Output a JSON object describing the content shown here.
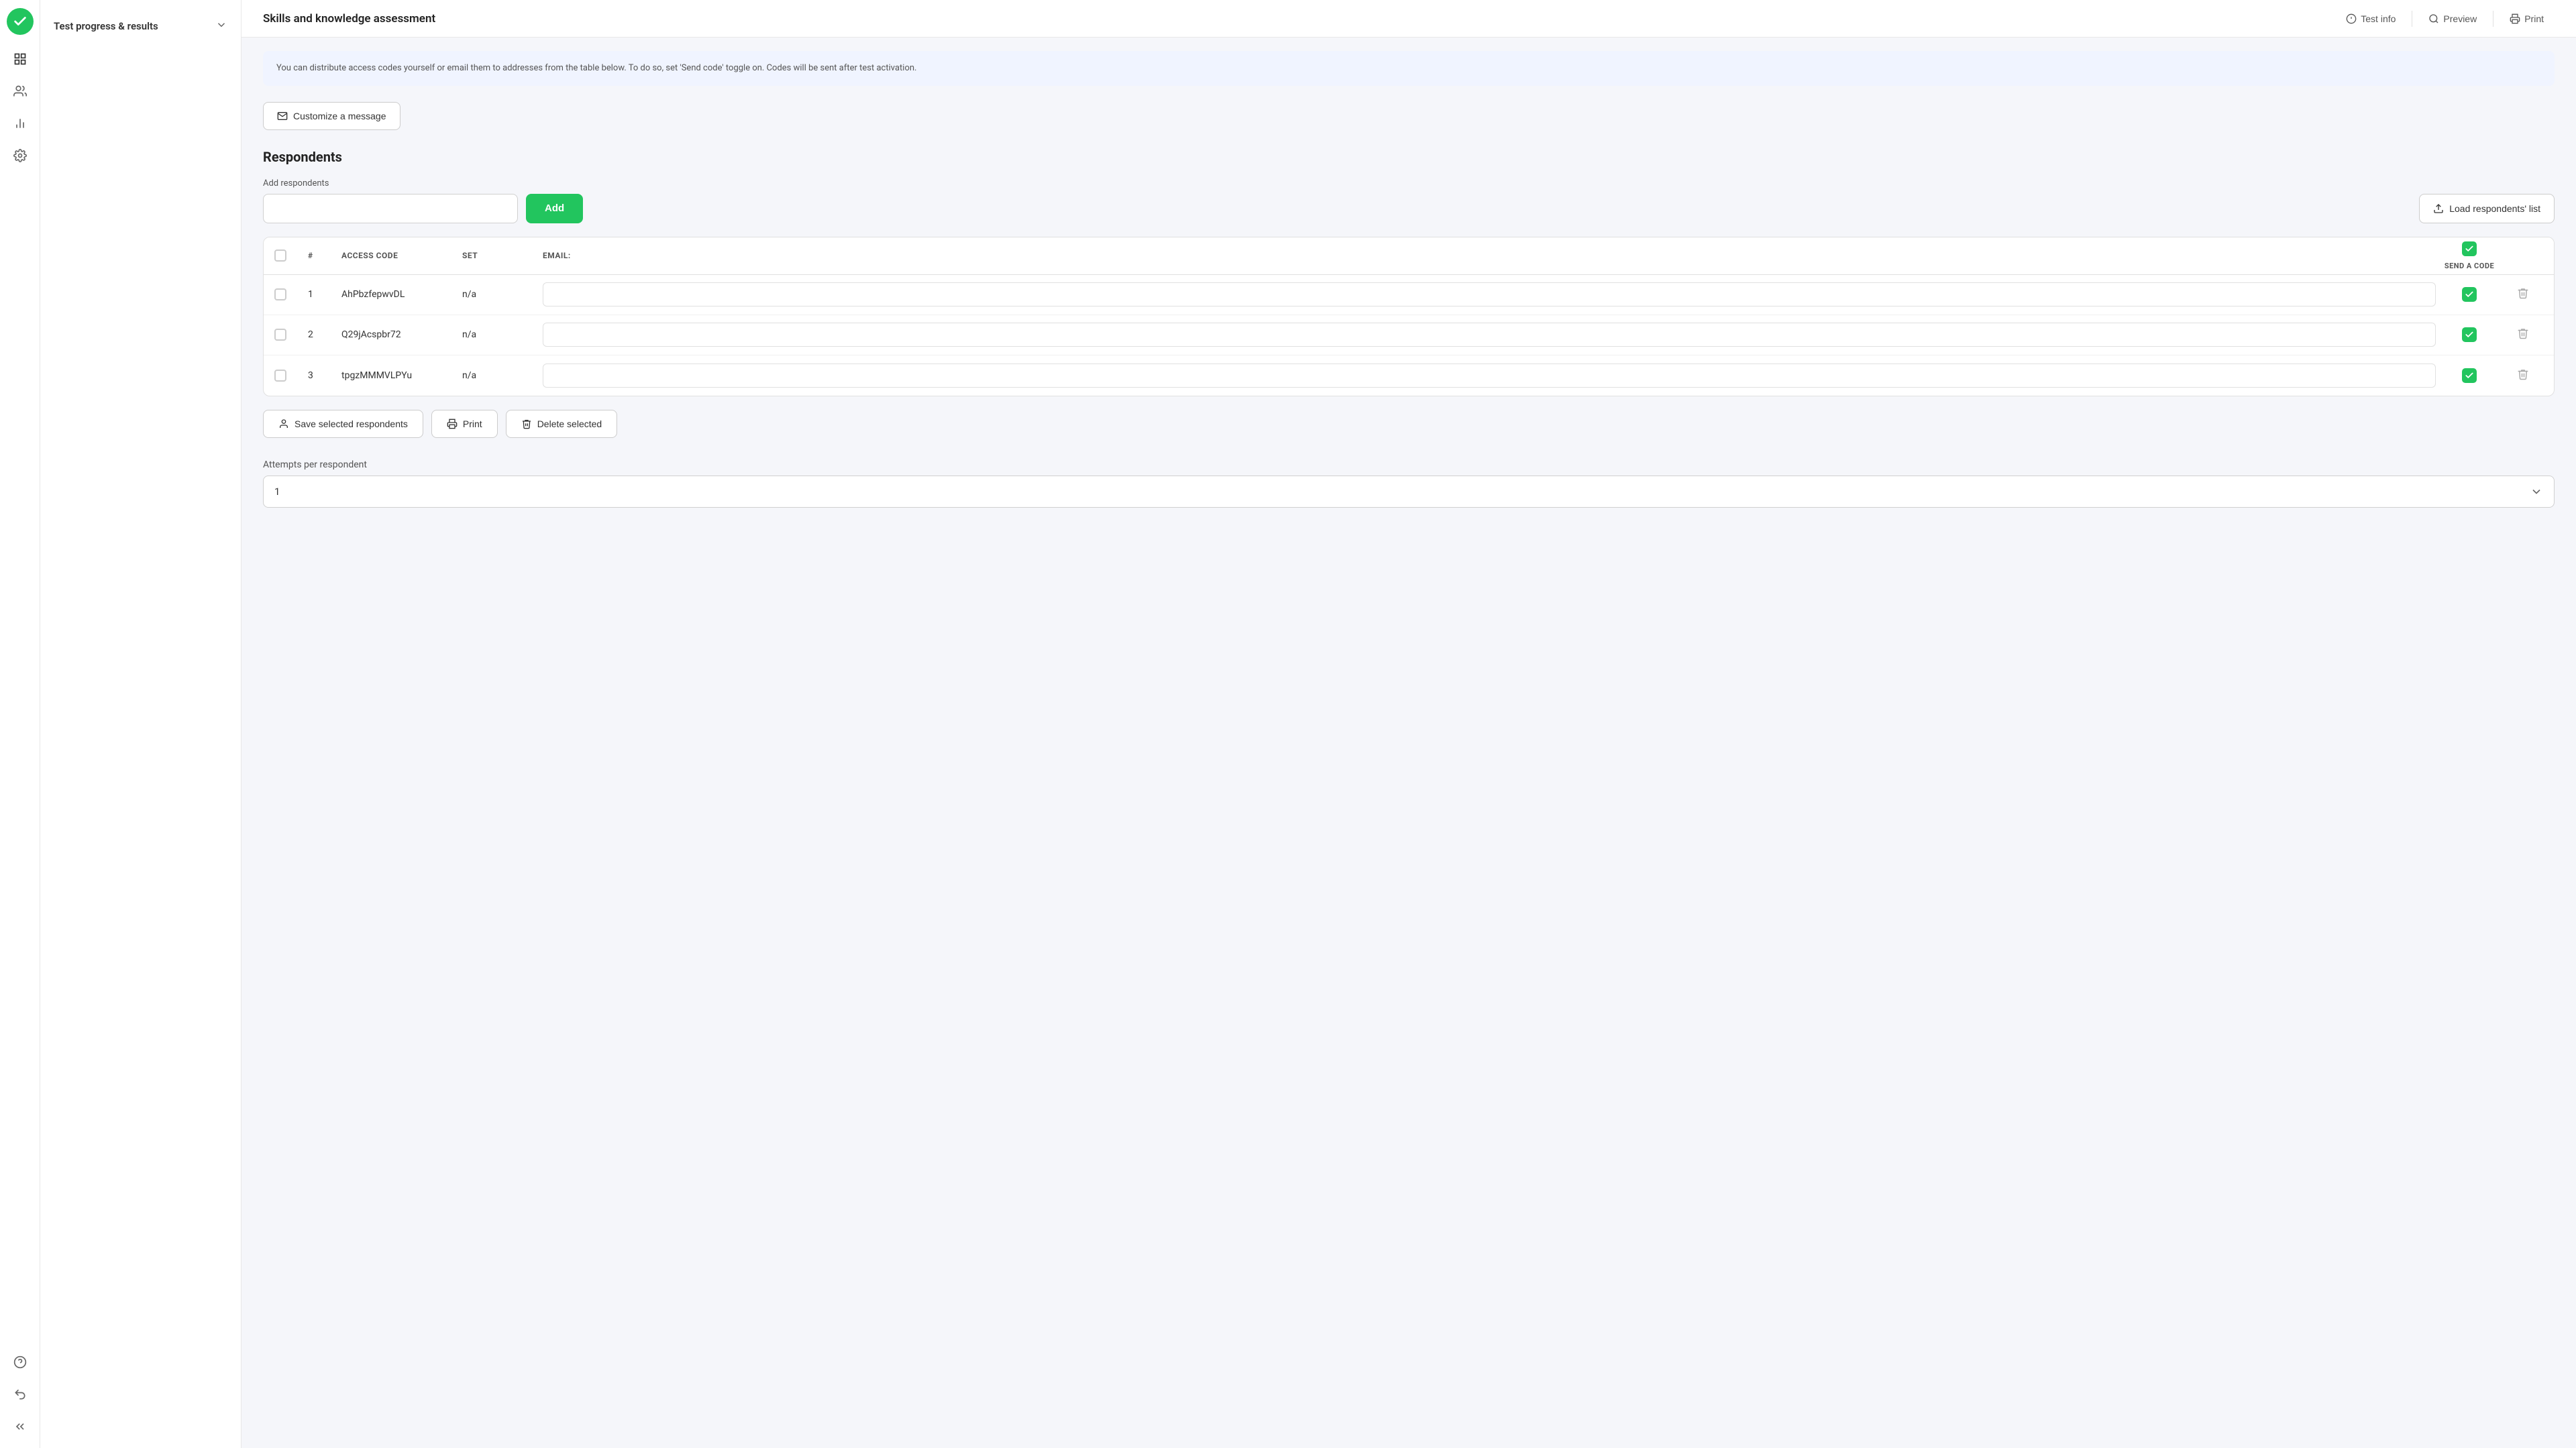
{
  "app": {
    "logo_icon": "check-icon",
    "title": "Skills and knowledge assessment"
  },
  "header": {
    "title": "Skills and knowledge assessment",
    "test_info_label": "Test info",
    "preview_label": "Preview",
    "print_label": "Print"
  },
  "icon_nav": {
    "items": [
      {
        "name": "grid-icon",
        "label": "Dashboard"
      },
      {
        "name": "users-icon",
        "label": "Users"
      },
      {
        "name": "chart-icon",
        "label": "Reports"
      },
      {
        "name": "settings-icon",
        "label": "Settings"
      }
    ],
    "bottom_items": [
      {
        "name": "help-icon",
        "label": "Help"
      },
      {
        "name": "back-icon",
        "label": "Back"
      },
      {
        "name": "collapse-icon",
        "label": "Collapse"
      }
    ]
  },
  "sidebar": {
    "section_label": "Test progress & results",
    "chevron": "chevron-down-icon"
  },
  "content": {
    "info_banner_text": "You can distribute access codes yourself or email them to addresses from the table below. To do so, set 'Send code' toggle on. Codes will be sent after test activation.",
    "customize_btn_label": "Customize a message",
    "respondents_title": "Respondents",
    "add_respondents_label": "Add respondents",
    "add_input_placeholder": "",
    "add_btn_label": "Add",
    "load_btn_label": "Load respondents' list",
    "table": {
      "columns": [
        "",
        "#",
        "ACCESS CODE",
        "SET",
        "EMAIL:",
        "",
        "SEND A CODE",
        ""
      ],
      "rows": [
        {
          "id": 1,
          "num": "1",
          "access_code": "AhPbzfepwvDL",
          "set": "n/a",
          "email": "",
          "send_code": true
        },
        {
          "id": 2,
          "num": "2",
          "access_code": "Q29jAcspbr72",
          "set": "n/a",
          "email": "",
          "send_code": true
        },
        {
          "id": 3,
          "num": "3",
          "access_code": "tpgzMMMVLPYu",
          "set": "n/a",
          "email": "",
          "send_code": true
        }
      ]
    },
    "save_btn_label": "Save selected respondents",
    "print_btn_label": "Print",
    "delete_btn_label": "Delete selected",
    "attempts_label": "Attempts per respondent",
    "attempts_value": "1"
  }
}
